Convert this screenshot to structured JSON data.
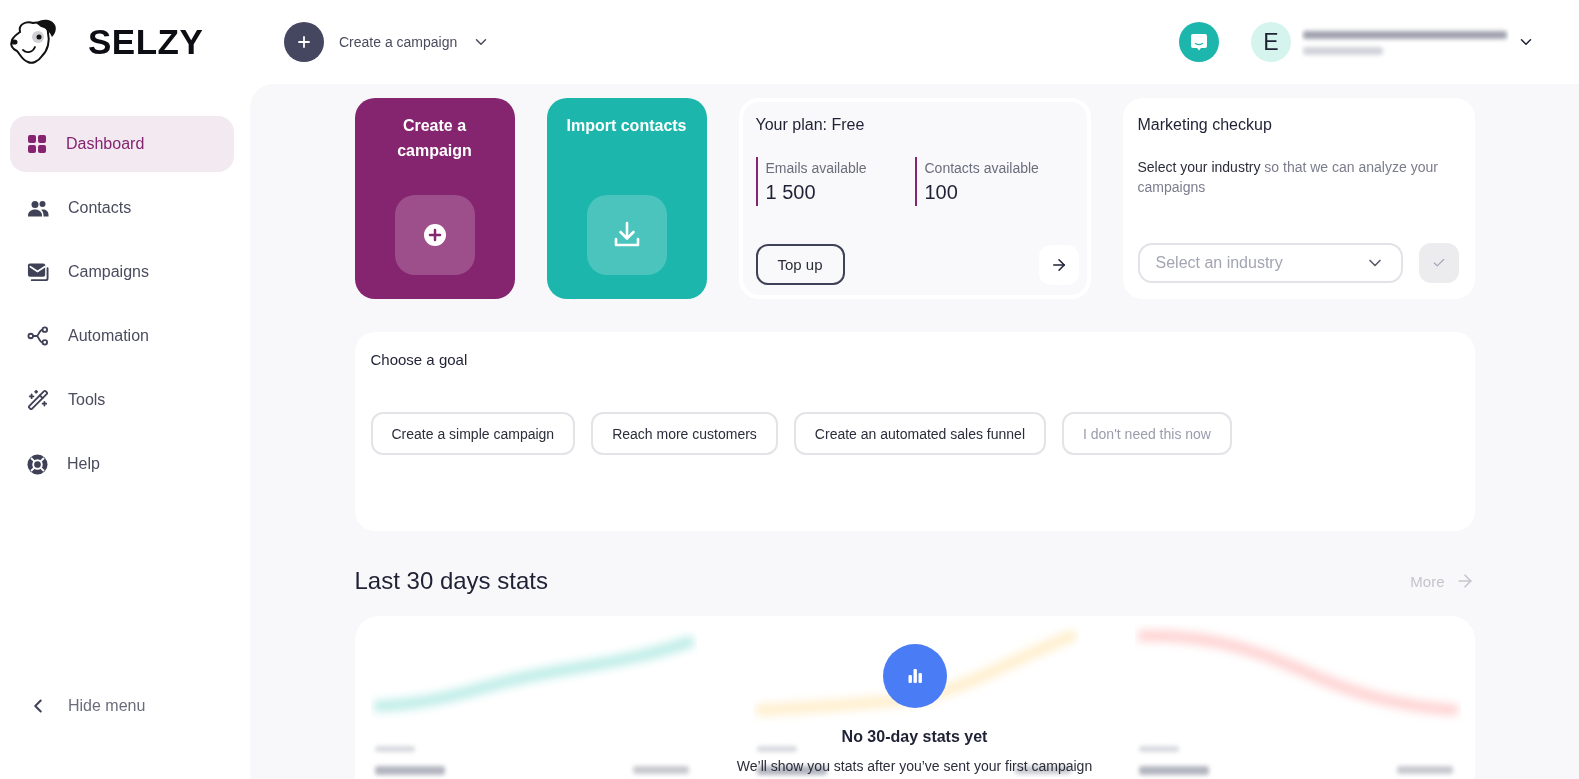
{
  "header": {
    "brand": "SELZY",
    "create_menu": {
      "label": "Create a campaign"
    },
    "account": {
      "initial": "E"
    }
  },
  "sidebar": {
    "items": [
      {
        "label": "Dashboard",
        "selected": true
      },
      {
        "label": "Contacts",
        "selected": false
      },
      {
        "label": "Campaigns",
        "selected": false
      },
      {
        "label": "Automation",
        "selected": false
      },
      {
        "label": "Tools",
        "selected": false
      },
      {
        "label": "Help",
        "selected": false
      }
    ],
    "collapse": {
      "label": "Hide menu"
    }
  },
  "quick_actions": [
    {
      "kind": "create",
      "title": "Create a campaign"
    },
    {
      "kind": "import",
      "title": "Import contacts"
    }
  ],
  "plan": {
    "title": "Your plan: Free",
    "stats": [
      {
        "label": "Emails available",
        "value": "1 500"
      },
      {
        "label": "Contacts available",
        "value": "100"
      }
    ],
    "top_up": {
      "label": "Top up"
    }
  },
  "checkup": {
    "title": "Marketing checkup",
    "description": {
      "emphasis": "Select your industry",
      "rest": "so that we can analyze your campaigns"
    },
    "industry_select": {
      "placeholder": "Select an industry"
    },
    "confirm": {
      "disabled": true
    }
  },
  "goals": {
    "title": "Choose a goal",
    "options": [
      {
        "kind": "goal",
        "label": "Create a simple campaign"
      },
      {
        "kind": "goal",
        "label": "Reach more customers"
      },
      {
        "kind": "goal",
        "label": "Create an automated sales funnel"
      },
      {
        "kind": "skip",
        "label": "I don't need this now"
      }
    ]
  },
  "stats": {
    "title": "Last 30 days stats",
    "more": {
      "label": "More",
      "disabled": true
    },
    "empty_state": {
      "title": "No 30-day stats yet",
      "text": "We’ll show you stats after you’ve sent your first campaign"
    }
  }
}
